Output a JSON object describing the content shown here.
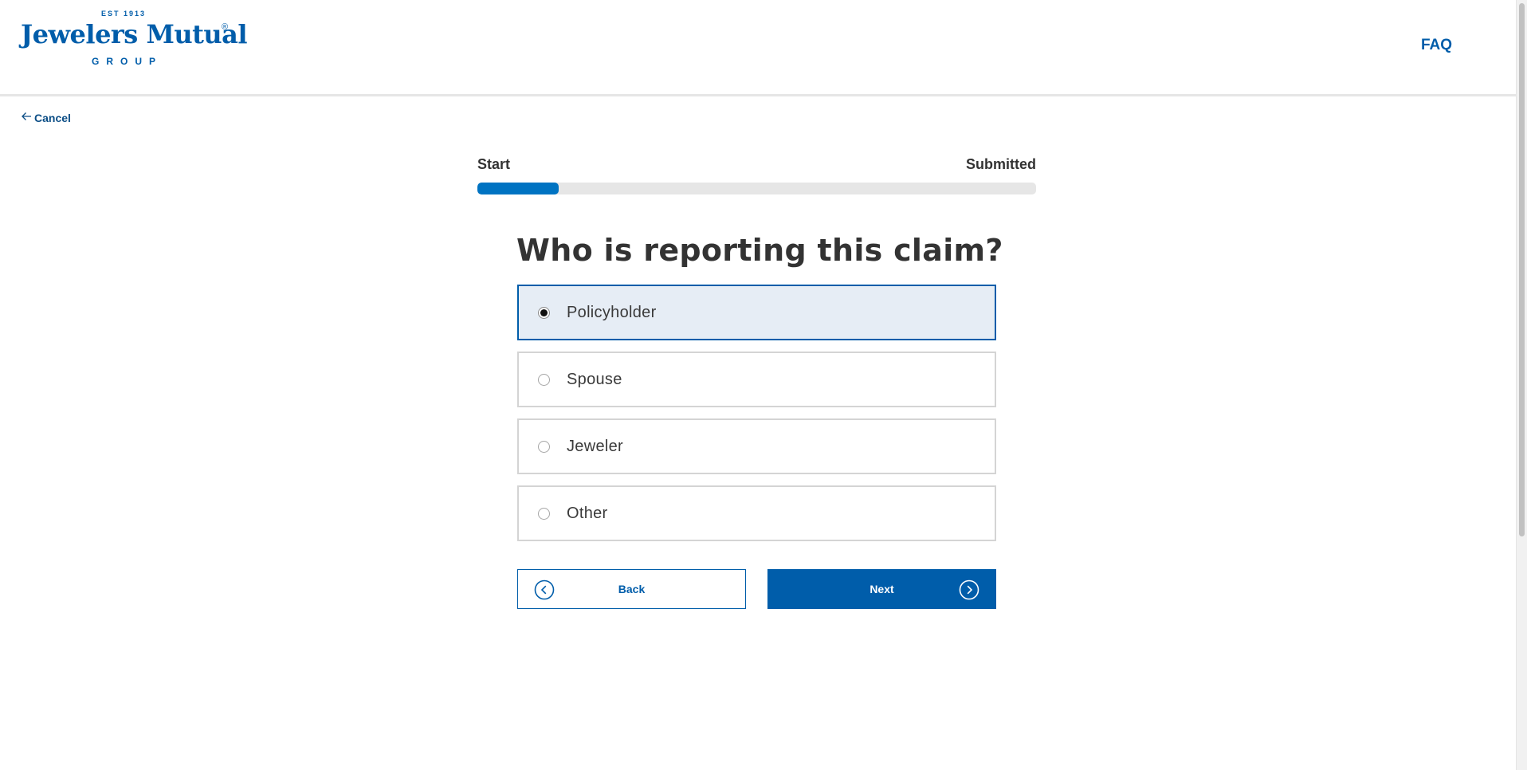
{
  "header": {
    "logo": {
      "est": "EST 1913",
      "name": "Jewelers Mutual",
      "registered": "®",
      "group": "GROUP"
    },
    "faq_label": "FAQ"
  },
  "nav": {
    "cancel_label": "Cancel"
  },
  "progress": {
    "start_label": "Start",
    "end_label": "Submitted",
    "fraction": 0.145
  },
  "question": {
    "title": "Who is reporting this claim?",
    "options": [
      {
        "label": "Policyholder",
        "selected": true
      },
      {
        "label": "Spouse",
        "selected": false
      },
      {
        "label": "Jeweler",
        "selected": false
      },
      {
        "label": "Other",
        "selected": false
      }
    ]
  },
  "actions": {
    "back_label": "Back",
    "next_label": "Next"
  },
  "colors": {
    "brand_blue": "#005daa",
    "progress_blue": "#0073c2",
    "selected_bg": "#e6edf5",
    "track_gray": "#e6e6e6"
  },
  "icons": {
    "cancel": "arrow-left-icon",
    "back": "chevron-left-circle-icon",
    "next": "chevron-right-circle-icon"
  }
}
